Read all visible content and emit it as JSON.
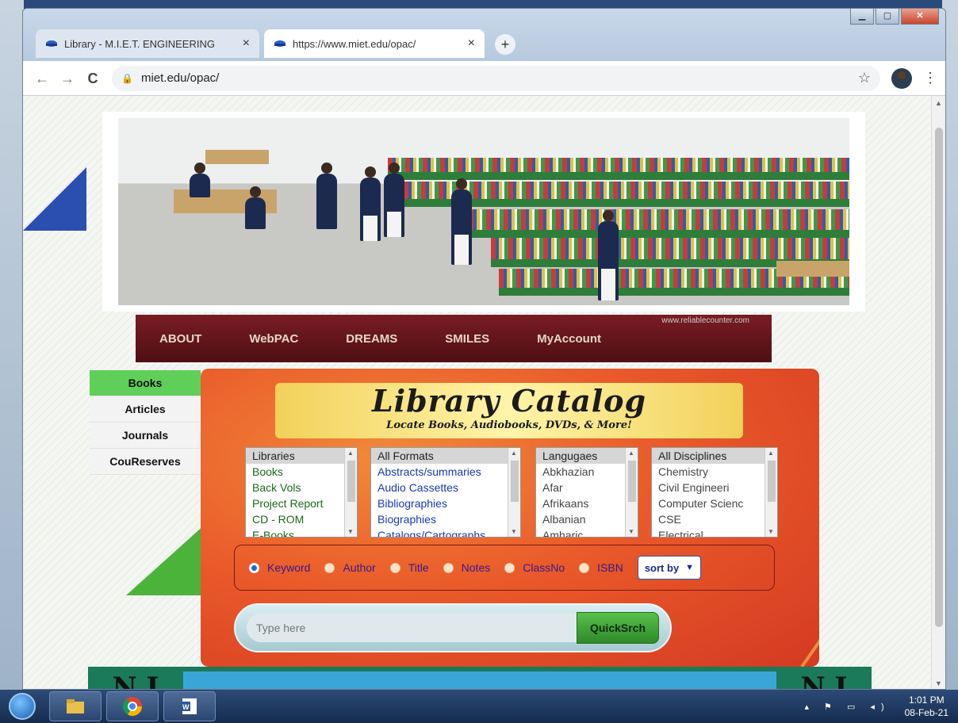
{
  "browser": {
    "tabs": [
      {
        "title": "Library - M.I.E.T. ENGINEERING",
        "active": false
      },
      {
        "title": "https://www.miet.edu/opac/",
        "active": true
      }
    ],
    "new_tab_label": "+",
    "close_glyph": "×",
    "url": "miet.edu/opac/"
  },
  "menu": {
    "items": [
      "ABOUT",
      "WebPAC",
      "DREAMS",
      "SMILES",
      "MyAccount"
    ],
    "counter_alt": "www.reliablecounter.com"
  },
  "side_tabs": [
    "Books",
    "Articles",
    "Journals",
    "CouReserves"
  ],
  "catalog": {
    "title": "Library Catalog",
    "subtitle": "Locate Books, Audiobooks, DVDs, & More!"
  },
  "lists": {
    "libraries": [
      "Libraries",
      "Books",
      "Back Vols",
      "Project Report",
      "CD - ROM",
      "E-Books"
    ],
    "formats": [
      "All Formats",
      "Abstracts/summaries",
      "Audio Cassettes",
      "Bibliographies",
      "Biographies",
      "Catalogs/Cartographs"
    ],
    "languages": [
      "Langugaes",
      "Abkhazian",
      "Afar",
      "Afrikaans",
      "Albanian",
      "Amharic"
    ],
    "disciplines": [
      "All Disciplines",
      "Chemistry",
      "Civil Engineeri",
      "Computer Scienc",
      "CSE",
      "Electrical"
    ]
  },
  "search_options": {
    "radios": [
      "Keyword",
      "Author",
      "Title",
      "Notes",
      "ClassNo",
      "ISBN"
    ],
    "selected": "Keyword",
    "sort_label": "sort by"
  },
  "search": {
    "placeholder": "Type here",
    "button": "QuickSrch"
  },
  "footer": {
    "logo_left": "N I",
    "logo_right": "N I"
  },
  "taskbar": {
    "time": "1:01 PM",
    "date": "08-Feb-21"
  },
  "colors": {
    "menu_bg": "#6a1820",
    "panel_orange": "#ea5a2a",
    "active_tab_green": "#5fcf5a",
    "search_button_green": "#3aa33a"
  }
}
